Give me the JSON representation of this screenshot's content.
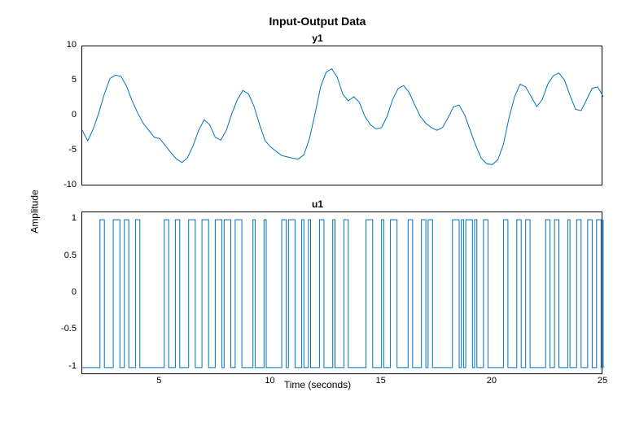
{
  "title": "Input-Output Data",
  "ylabel": "Amplitude",
  "xlabel": "Time (seconds)",
  "chart_data": [
    {
      "type": "line",
      "name": "y1",
      "title": "y1",
      "xlim": [
        1.5,
        25
      ],
      "ylim": [
        -10,
        10
      ],
      "yticks": [
        -10,
        -5,
        0,
        5,
        10
      ],
      "x": [
        1.5,
        1.75,
        2,
        2.25,
        2.5,
        2.75,
        3,
        3.25,
        3.5,
        3.75,
        4,
        4.25,
        4.5,
        4.75,
        5,
        5.25,
        5.5,
        5.75,
        6,
        6.25,
        6.5,
        6.75,
        7,
        7.25,
        7.5,
        7.75,
        8,
        8.25,
        8.5,
        8.75,
        9,
        9.25,
        9.5,
        9.75,
        10,
        10.25,
        10.5,
        10.75,
        11,
        11.25,
        11.5,
        11.75,
        12,
        12.25,
        12.5,
        12.75,
        13,
        13.25,
        13.5,
        13.75,
        14,
        14.25,
        14.5,
        14.75,
        15,
        15.25,
        15.5,
        15.75,
        16,
        16.25,
        16.5,
        16.75,
        17,
        17.25,
        17.5,
        17.75,
        18,
        18.25,
        18.5,
        18.75,
        19,
        19.25,
        19.5,
        19.75,
        20,
        20.25,
        20.5,
        20.75,
        21,
        21.25,
        21.5,
        21.75,
        22,
        22.25,
        22.5,
        22.75,
        23,
        23.25,
        23.5,
        23.75,
        24,
        24.25,
        24.5,
        24.75,
        25
      ],
      "values": [
        -2.0,
        -3.5,
        -1.8,
        0.5,
        3.2,
        5.4,
        5.9,
        5.7,
        4.3,
        2.2,
        0.5,
        -1.0,
        -2.0,
        -3.0,
        -3.2,
        -4.2,
        -5.2,
        -6.1,
        -6.6,
        -5.9,
        -4.2,
        -2.0,
        -0.5,
        -1.2,
        -3.0,
        -3.4,
        -2.0,
        0.4,
        2.4,
        3.7,
        3.2,
        1.4,
        -1.2,
        -3.5,
        -4.4,
        -5.0,
        -5.6,
        -5.8,
        -6.0,
        -6.1,
        -5.5,
        -3.2,
        0.4,
        4.2,
        6.3,
        6.8,
        5.6,
        3.2,
        2.2,
        2.8,
        2.0,
        0.0,
        -1.2,
        -1.8,
        -1.6,
        0.0,
        2.4,
        4.0,
        4.4,
        3.4,
        1.6,
        0.0,
        -1.0,
        -1.6,
        -2.0,
        -1.6,
        -0.2,
        1.4,
        1.6,
        0.2,
        -2.0,
        -4.2,
        -6.0,
        -6.8,
        -6.9,
        -6.2,
        -4.0,
        -0.2,
        2.8,
        4.6,
        4.2,
        2.8,
        1.4,
        2.4,
        4.6,
        5.8,
        6.2,
        5.2,
        3.0,
        1.0,
        0.8,
        2.4,
        4.0,
        4.2,
        2.8
      ],
      "xticks": []
    },
    {
      "type": "line",
      "name": "u1",
      "title": "u1",
      "xlim": [
        1.5,
        25
      ],
      "ylim": [
        -1.1,
        1.1
      ],
      "yticks": [
        -1,
        -0.5,
        0,
        0.5,
        1
      ],
      "xticks": [
        5,
        10,
        15,
        20,
        25
      ],
      "transitions": [
        1.5,
        2.3,
        2.5,
        2.9,
        3.2,
        3.4,
        3.6,
        3.9,
        4.1,
        5.2,
        5.4,
        5.7,
        5.9,
        6.3,
        6.6,
        6.9,
        7.2,
        7.5,
        7.8,
        7.9,
        8.2,
        8.4,
        8.7,
        9.2,
        9.3,
        9.7,
        9.8,
        10.5,
        10.7,
        10.8,
        11.1,
        11.4,
        11.5,
        11.7,
        11.8,
        12.2,
        12.4,
        12.8,
        12.9,
        13.3,
        13.5,
        14.3,
        14.6,
        15.0,
        15.1,
        15.4,
        15.7,
        16.2,
        16.4,
        16.8,
        17.0,
        17.1,
        17.3,
        18.2,
        18.5,
        18.6,
        18.7,
        18.8,
        19.1,
        19.2,
        19.3,
        19.6,
        19.8,
        20.5,
        20.7,
        21.1,
        21.3,
        21.5,
        21.7,
        22.4,
        22.6,
        22.8,
        23.0,
        23.4,
        23.5,
        23.8,
        24.0,
        24.3,
        24.5,
        24.7,
        24.9,
        25
      ],
      "start_level": -1
    }
  ]
}
